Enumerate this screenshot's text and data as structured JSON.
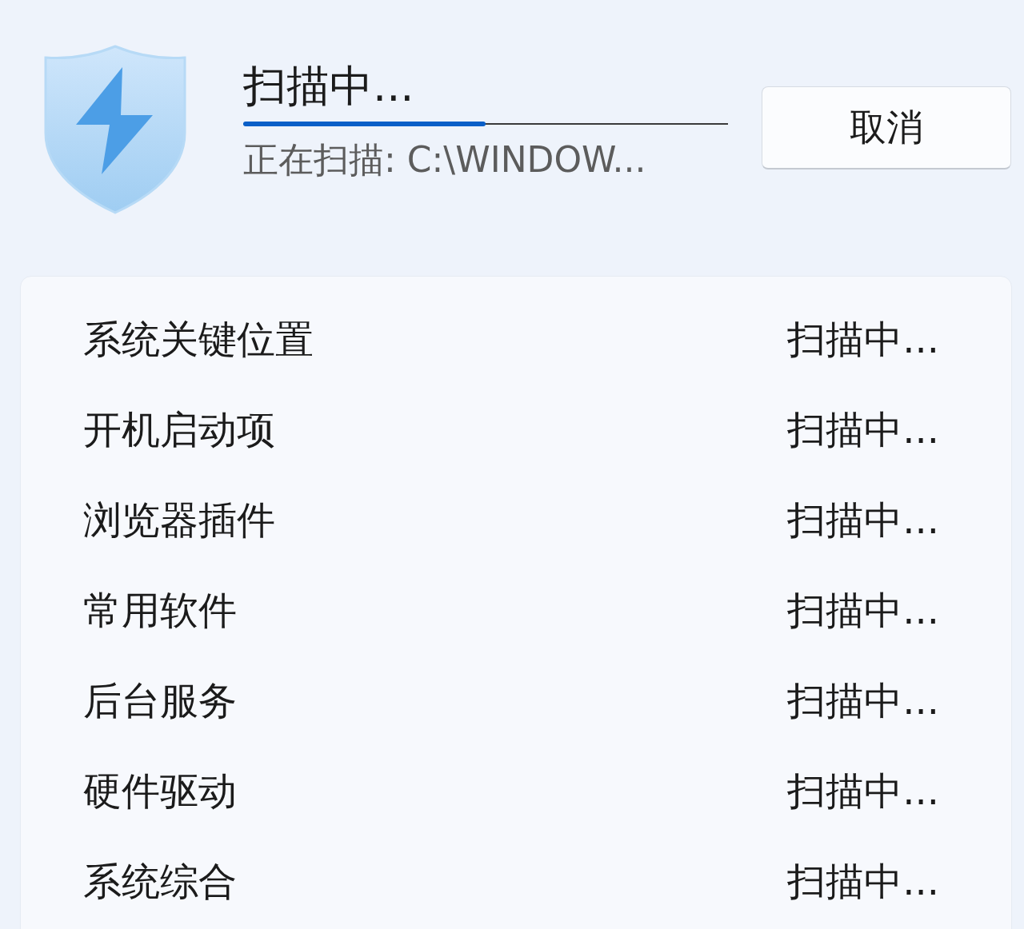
{
  "header": {
    "title": "扫描中...",
    "progress": {
      "level": 0.5
    },
    "status": "正在扫描: C:\\WINDOW...",
    "cancel_button": "取消"
  },
  "items": [
    {
      "name": "系统关键位置",
      "status": "扫描中..."
    },
    {
      "name": "开机启动项",
      "status": "扫描中..."
    },
    {
      "name": "浏览器插件",
      "status": "扫描中..."
    },
    {
      "name": "常用软件",
      "status": "扫描中..."
    },
    {
      "name": "后台服务",
      "status": "扫描中..."
    },
    {
      "name": "硬件驱动",
      "status": "扫描中..."
    },
    {
      "name": "系统综合",
      "status": "扫描中..."
    }
  ]
}
